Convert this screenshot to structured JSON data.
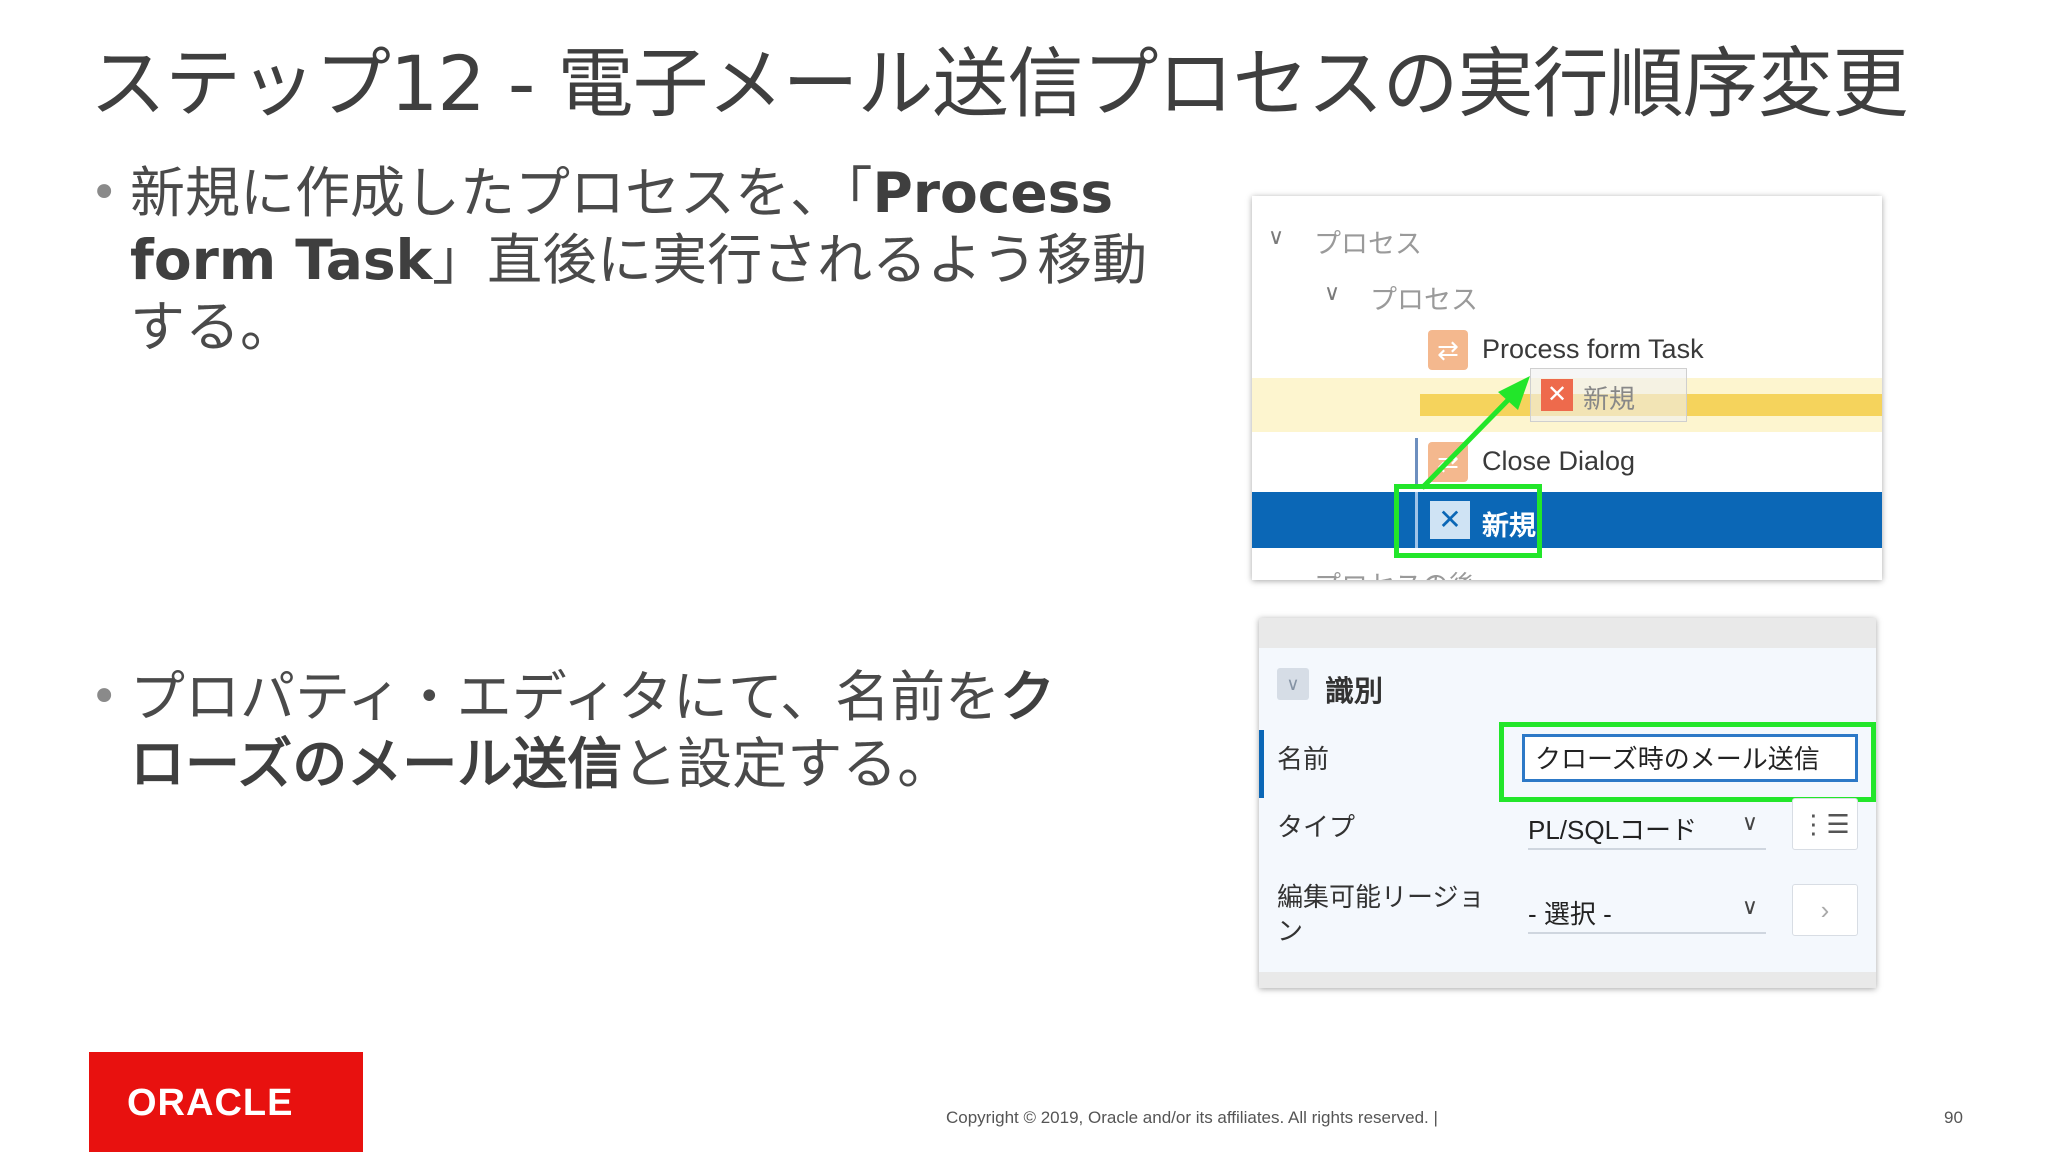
{
  "slide": {
    "title": "ステップ12 - 電子メール送信プロセスの実行順序変更",
    "bullet1": {
      "marker": "•",
      "line1_a": "新規に作成したプロセスを、「",
      "line1_b": "Process",
      "line2_a": "form Task",
      "line2_b": "」直後に実行されるよう移動",
      "line3": "する。"
    },
    "bullet2": {
      "marker": "•",
      "line1_a": "プロパティ・エディタにて、名前を",
      "line1_b": "ク",
      "line2_a": "ローズのメール送信",
      "line2_b": "と設定する。"
    }
  },
  "tree": {
    "root_label": "プロセス",
    "child_label": "プロセス",
    "item1": "Process form Task",
    "ghost_label": "新規",
    "item2": "Close Dialog",
    "selected_label": "新規",
    "after_label": "プロセスの後",
    "chevron": "∨",
    "process_glyph": "⇄",
    "close_glyph": "✕"
  },
  "properties": {
    "section": "識別",
    "section_toggle": "∨",
    "name_label": "名前",
    "name_value": "クローズ時のメール送信",
    "type_label": "タイプ",
    "type_value": "PL/SQLコード",
    "region_label_1": "編集可能リージョ",
    "region_label_2": "ン",
    "region_value": "- 選択 -",
    "chevron": "∨",
    "list_glyph": "⋮☰",
    "next_glyph": "›"
  },
  "footer": {
    "logo_text": "ORACLE",
    "copyright": "Copyright © 2019, Oracle and/or its affiliates. All rights reserved.  |",
    "page_number": "90"
  },
  "colors": {
    "selection_blue": "#0b67b6",
    "highlight_green": "#22e62a",
    "oracle_red": "#e8110f",
    "drop_yellow": "#f5d35c"
  }
}
